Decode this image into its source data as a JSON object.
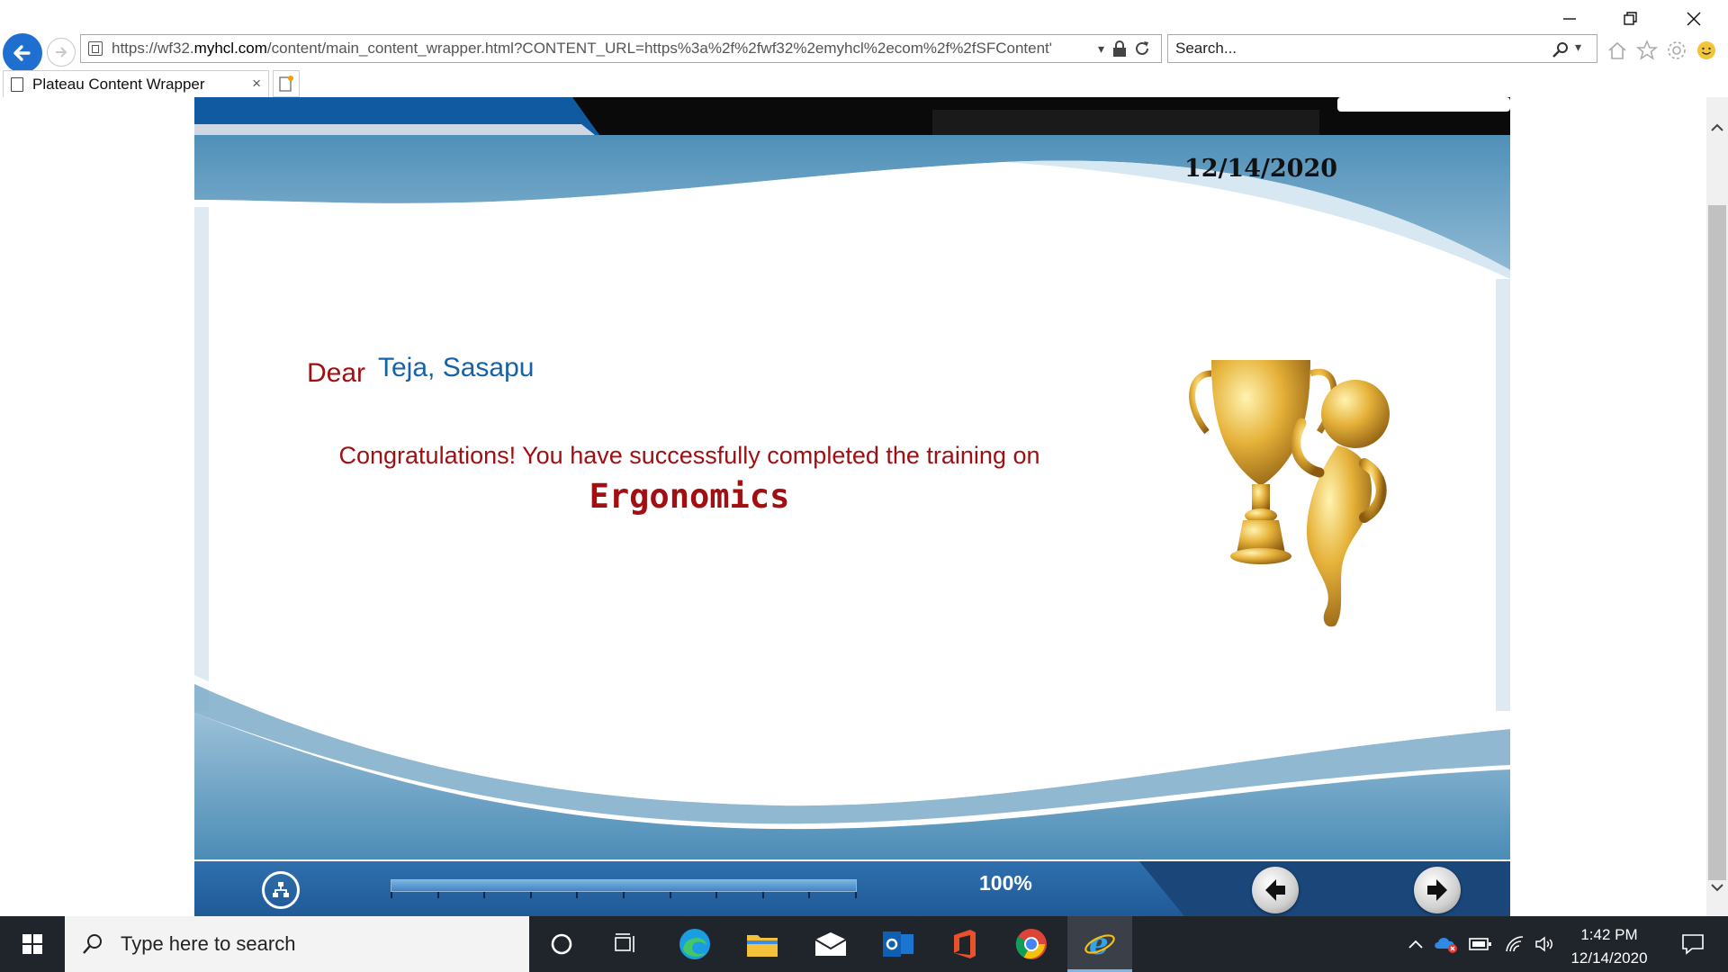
{
  "browser": {
    "url_prefix": "https://wf32.",
    "url_domain": "myhcl.com",
    "url_rest": "/content/main_content_wrapper.html?CONTENT_URL=https%3a%2f%2fwf32%2emyhcl%2ecom%2f%2fSFContent'",
    "search_placeholder": "Search...",
    "tab_title": "Plateau Content Wrapper",
    "tab_close": "×"
  },
  "slide": {
    "date": "12/14/2020",
    "dear": "Dear",
    "learner_name": "Teja, Sasapu",
    "congrats": "Congratulations! You have successfully completed the training on",
    "course_title": "Ergonomics"
  },
  "player": {
    "progress_percent": 100,
    "progress_label": "100%"
  },
  "taskbar": {
    "search_placeholder": "Type here to search",
    "time": "1:42 PM",
    "date": "12/14/2020"
  },
  "colors": {
    "accent_red": "#a10f12",
    "name_blue": "#1563a6",
    "bar_blue": "#2f6fae"
  }
}
